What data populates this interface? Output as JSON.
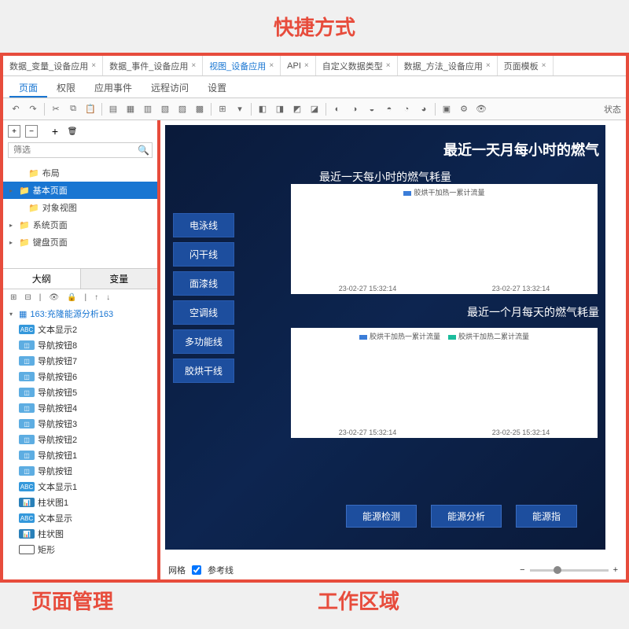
{
  "header_label": "快捷方式",
  "footer_left": "页面管理",
  "footer_right": "工作区域",
  "tabs": [
    {
      "label": "数据_变量_设备应用",
      "active": false
    },
    {
      "label": "数据_事件_设备应用",
      "active": false
    },
    {
      "label": "视图_设备应用",
      "active": true
    },
    {
      "label": "API",
      "active": false
    },
    {
      "label": "自定义数据类型",
      "active": false
    },
    {
      "label": "数据_方法_设备应用",
      "active": false
    },
    {
      "label": "页面模板",
      "active": false
    }
  ],
  "subtabs": [
    {
      "label": "页面",
      "active": true
    },
    {
      "label": "权限",
      "active": false
    },
    {
      "label": "应用事件",
      "active": false
    },
    {
      "label": "远程访问",
      "active": false
    },
    {
      "label": "设置",
      "active": false
    }
  ],
  "status_label": "状态",
  "search_placeholder": "筛选",
  "tree": [
    {
      "label": "布局",
      "indent": true,
      "selected": false,
      "chev": ""
    },
    {
      "label": "基本页面",
      "indent": false,
      "selected": true,
      "chev": "▸"
    },
    {
      "label": "对象视图",
      "indent": true,
      "selected": false,
      "chev": ""
    },
    {
      "label": "系统页面",
      "indent": false,
      "selected": false,
      "chev": "▸"
    },
    {
      "label": "键盘页面",
      "indent": false,
      "selected": false,
      "chev": "▸"
    }
  ],
  "panel_tabs": {
    "outline": "大纲",
    "vars": "变量"
  },
  "outline_root": "163:充隆能源分析163",
  "outline": [
    {
      "icon": "abc",
      "label": "文本显示2"
    },
    {
      "icon": "btn",
      "label": "导航按钮8"
    },
    {
      "icon": "btn",
      "label": "导航按钮7"
    },
    {
      "icon": "btn",
      "label": "导航按钮6"
    },
    {
      "icon": "btn",
      "label": "导航按钮5"
    },
    {
      "icon": "btn",
      "label": "导航按钮4"
    },
    {
      "icon": "btn",
      "label": "导航按钮3"
    },
    {
      "icon": "btn",
      "label": "导航按钮2"
    },
    {
      "icon": "btn",
      "label": "导航按钮1"
    },
    {
      "icon": "btn",
      "label": "导航按钮"
    },
    {
      "icon": "abc",
      "label": "文本显示1"
    },
    {
      "icon": "chart",
      "label": "柱状图1"
    },
    {
      "icon": "abc",
      "label": "文本显示"
    },
    {
      "icon": "chart",
      "label": "柱状图"
    },
    {
      "icon": "rect",
      "label": "矩形"
    }
  ],
  "canvas": {
    "title": "最近一天月每小时的燃气",
    "subtitle": "最近一天每小时的燃气耗量",
    "chart1_legend": "胶烘干加热一累计流量",
    "chart1_x": [
      "23-02-27 15:32:14",
      "23-02-27 13:32:14"
    ],
    "chart2_title": "最近一个月每天的燃气耗量",
    "chart2_legend1": "胶烘干加热一累计流量",
    "chart2_legend2": "胶烘干加热二累计流量",
    "chart2_x": [
      "23-02-27 15:32:14",
      "23-02-25 15:32:14"
    ],
    "nav_btns": [
      "电泳线",
      "闪干线",
      "面漆线",
      "空调线",
      "多功能线",
      "胶烘干线"
    ],
    "action_btns": [
      "能源检测",
      "能源分析",
      "能源指"
    ]
  },
  "footer": {
    "grid": "网格",
    "guides": "参考线"
  },
  "chart_data": [
    {
      "type": "bar",
      "title": "最近一天每小时的燃气耗量",
      "series": [
        {
          "name": "胶烘干加热一累计流量",
          "values": []
        }
      ],
      "categories": [
        "23-02-27 15:32:14",
        "23-02-27 13:32:14"
      ],
      "xlabel": "",
      "ylabel": "",
      "ylim": [
        0,
        100
      ]
    },
    {
      "type": "bar",
      "title": "最近一个月每天的燃气耗量",
      "series": [
        {
          "name": "胶烘干加热一累计流量",
          "values": []
        },
        {
          "name": "胶烘干加热二累计流量",
          "values": []
        }
      ],
      "categories": [
        "23-02-27 15:32:14",
        "23-02-25 15:32:14"
      ],
      "xlabel": "",
      "ylabel": "",
      "ylim": [
        0,
        100
      ]
    }
  ]
}
